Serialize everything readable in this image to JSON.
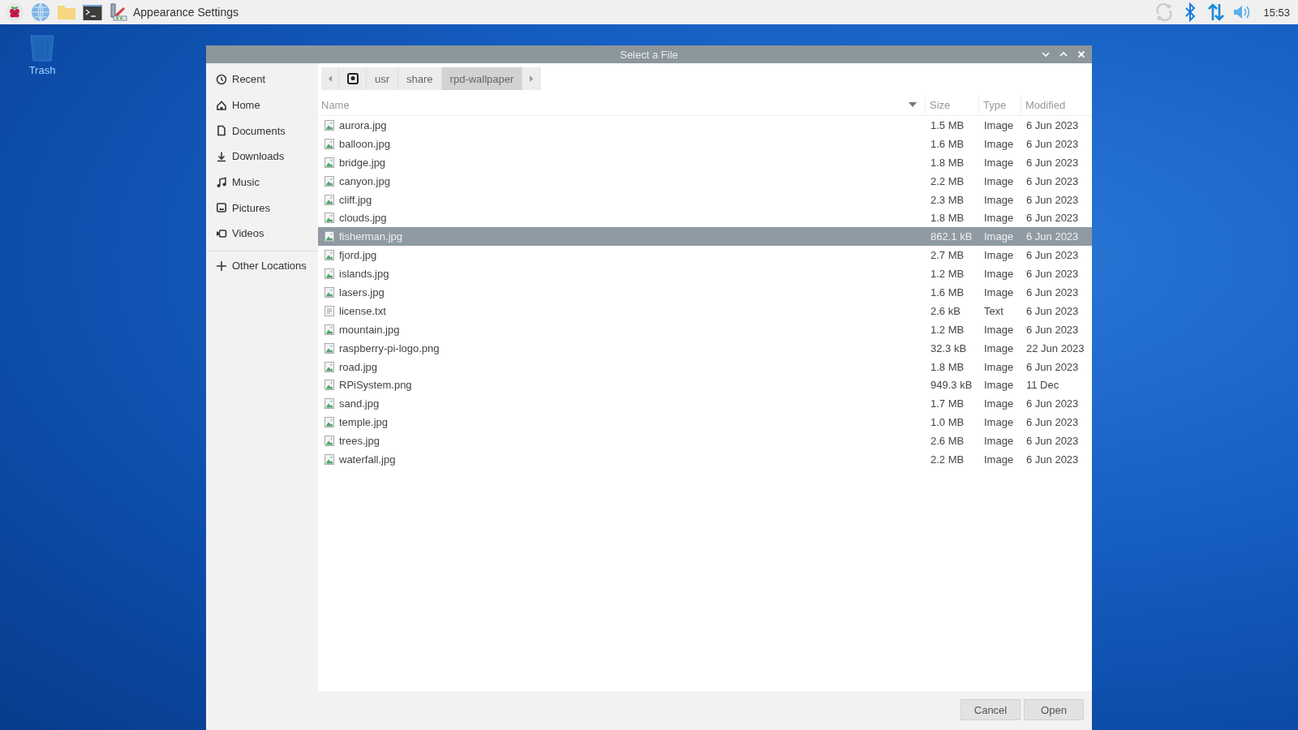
{
  "taskbar": {
    "app_title": "Appearance Settings",
    "clock": "15:53"
  },
  "desktop": {
    "icons": [
      {
        "label": "Trash"
      }
    ]
  },
  "dialog": {
    "title": "Select a File",
    "sidebar": {
      "items": [
        {
          "label": "Recent",
          "kind": "recent"
        },
        {
          "label": "Home",
          "kind": "home"
        },
        {
          "label": "Documents",
          "kind": "documents"
        },
        {
          "label": "Downloads",
          "kind": "downloads"
        },
        {
          "label": "Music",
          "kind": "music"
        },
        {
          "label": "Pictures",
          "kind": "pictures"
        },
        {
          "label": "Videos",
          "kind": "videos"
        }
      ],
      "other_locations": "Other Locations"
    },
    "path": [
      {
        "label": "usr",
        "selected": false
      },
      {
        "label": "share",
        "selected": false
      },
      {
        "label": "rpd-wallpaper",
        "selected": true
      }
    ],
    "table": {
      "columns": [
        "Name",
        "Size",
        "Type",
        "Modified"
      ],
      "rows": [
        {
          "name": "aurora.jpg",
          "size": "1.5 MB",
          "type": "Image",
          "modified": "6 Jun 2023",
          "kind": "image",
          "selected": false
        },
        {
          "name": "balloon.jpg",
          "size": "1.6 MB",
          "type": "Image",
          "modified": "6 Jun 2023",
          "kind": "image",
          "selected": false
        },
        {
          "name": "bridge.jpg",
          "size": "1.8 MB",
          "type": "Image",
          "modified": "6 Jun 2023",
          "kind": "image",
          "selected": false
        },
        {
          "name": "canyon.jpg",
          "size": "2.2 MB",
          "type": "Image",
          "modified": "6 Jun 2023",
          "kind": "image",
          "selected": false
        },
        {
          "name": "cliff.jpg",
          "size": "2.3 MB",
          "type": "Image",
          "modified": "6 Jun 2023",
          "kind": "image",
          "selected": false
        },
        {
          "name": "clouds.jpg",
          "size": "1.8 MB",
          "type": "Image",
          "modified": "6 Jun 2023",
          "kind": "image",
          "selected": false
        },
        {
          "name": "fisherman.jpg",
          "size": "862.1 kB",
          "type": "Image",
          "modified": "6 Jun 2023",
          "kind": "image",
          "selected": true
        },
        {
          "name": "fjord.jpg",
          "size": "2.7 MB",
          "type": "Image",
          "modified": "6 Jun 2023",
          "kind": "image",
          "selected": false
        },
        {
          "name": "islands.jpg",
          "size": "1.2 MB",
          "type": "Image",
          "modified": "6 Jun 2023",
          "kind": "image",
          "selected": false
        },
        {
          "name": "lasers.jpg",
          "size": "1.6 MB",
          "type": "Image",
          "modified": "6 Jun 2023",
          "kind": "image",
          "selected": false
        },
        {
          "name": "license.txt",
          "size": "2.6 kB",
          "type": "Text",
          "modified": "6 Jun 2023",
          "kind": "text",
          "selected": false
        },
        {
          "name": "mountain.jpg",
          "size": "1.2 MB",
          "type": "Image",
          "modified": "6 Jun 2023",
          "kind": "image",
          "selected": false
        },
        {
          "name": "raspberry-pi-logo.png",
          "size": "32.3 kB",
          "type": "Image",
          "modified": "22 Jun 2023",
          "kind": "image",
          "selected": false
        },
        {
          "name": "road.jpg",
          "size": "1.8 MB",
          "type": "Image",
          "modified": "6 Jun 2023",
          "kind": "image",
          "selected": false
        },
        {
          "name": "RPiSystem.png",
          "size": "949.3 kB",
          "type": "Image",
          "modified": "11 Dec",
          "kind": "image",
          "selected": false
        },
        {
          "name": "sand.jpg",
          "size": "1.7 MB",
          "type": "Image",
          "modified": "6 Jun 2023",
          "kind": "image",
          "selected": false
        },
        {
          "name": "temple.jpg",
          "size": "1.0 MB",
          "type": "Image",
          "modified": "6 Jun 2023",
          "kind": "image",
          "selected": false
        },
        {
          "name": "trees.jpg",
          "size": "2.6 MB",
          "type": "Image",
          "modified": "6 Jun 2023",
          "kind": "image",
          "selected": false
        },
        {
          "name": "waterfall.jpg",
          "size": "2.2 MB",
          "type": "Image",
          "modified": "6 Jun 2023",
          "kind": "image",
          "selected": false
        }
      ]
    },
    "buttons": [
      {
        "label": "Cancel"
      },
      {
        "label": "Open"
      }
    ]
  }
}
